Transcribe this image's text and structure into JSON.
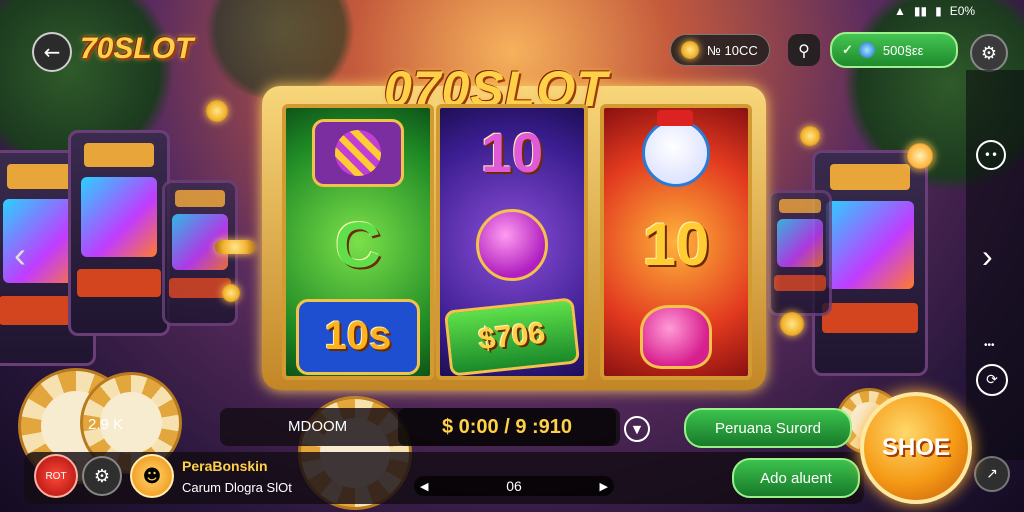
{
  "status_bar": {
    "battery": "E0%"
  },
  "header": {
    "logo_text": "70SLOT",
    "balance_label": "№ 10СС",
    "currency_label": "500§εε"
  },
  "reels": {
    "title": "070SLOT",
    "col1": [
      "",
      "C",
      "10s"
    ],
    "col2": [
      "10",
      "",
      "$706"
    ],
    "col3": [
      "",
      "10",
      ""
    ]
  },
  "info_row": {
    "left_value": "2.9 K",
    "mode_label": "MDOOM",
    "bet_display": "$ 0:00 / 9 :910",
    "green_button_1": "Peruana Surord"
  },
  "bottom_bar": {
    "left_badge": "ROT",
    "player_name": "PeraBonskin",
    "subtitle": "Carum Dlogra SlOt",
    "counter": "06",
    "green_button_2": "Ado aluent"
  },
  "spin_button": {
    "label": "SHOE"
  },
  "colors": {
    "gold": "#ffd148",
    "green": "#2fa93f",
    "orange": "#f59a16",
    "red": "#d11f1f"
  }
}
